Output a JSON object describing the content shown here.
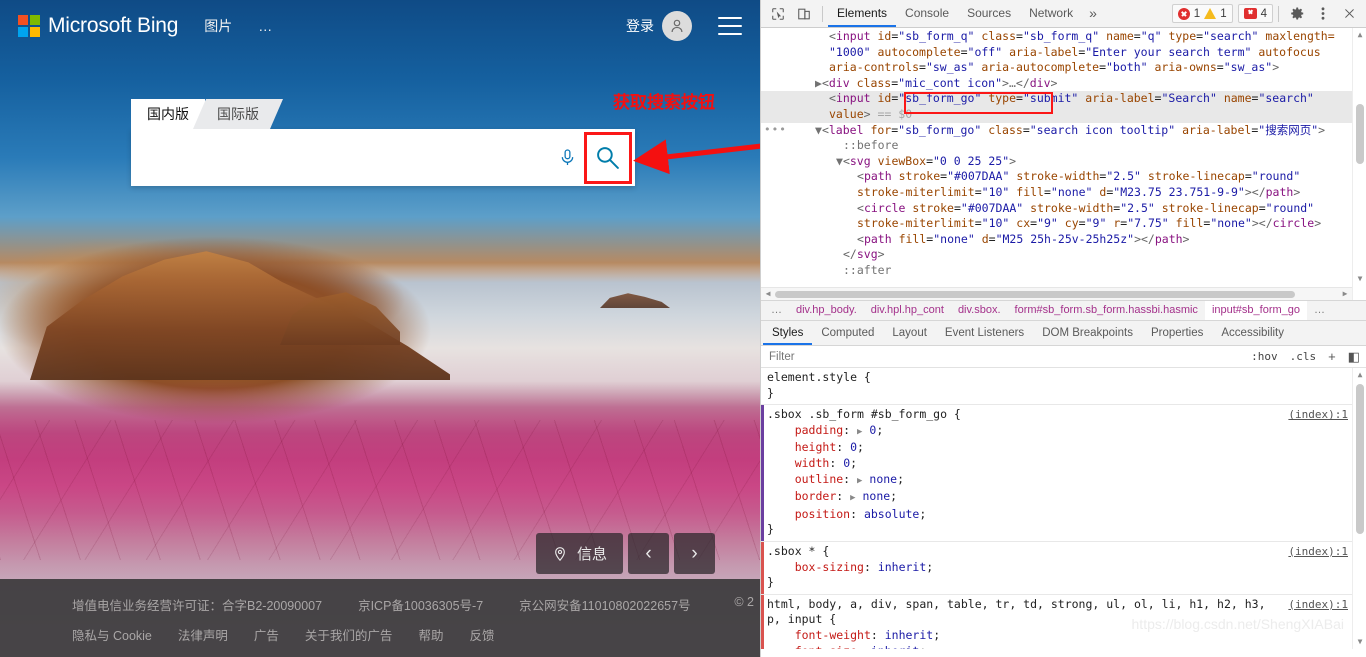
{
  "bing": {
    "brand": "Microsoft Bing",
    "nav": {
      "images": "图片",
      "more": "…"
    },
    "signin": "登录",
    "avatar_icon": "person-icon",
    "menu_icon": "hamburger-icon",
    "search": {
      "tab_domestic": "国内版",
      "tab_international": "国际版",
      "input_value": "",
      "input_placeholder": "",
      "mic_icon": "microphone-icon",
      "go_icon": "search-icon",
      "highlight_color": "#fb1717"
    },
    "annotation": {
      "text": "获取搜索按钮",
      "color": "#f41010"
    },
    "image_controls": {
      "info_label": "信息",
      "info_icon": "location-pin-icon",
      "prev_icon": "chevron-left-icon",
      "next_icon": "chevron-right-icon"
    },
    "footer": {
      "row1": [
        "增值电信业务经营许可证：合字B2-20090007",
        "京ICP备10036305号-7",
        "京公网安备11010802022657号"
      ],
      "copyright": "© 2",
      "row2": [
        "隐私与 Cookie",
        "法律声明",
        "广告",
        "关于我们的广告",
        "帮助",
        "反馈"
      ]
    }
  },
  "devtools": {
    "toolbar": {
      "inspect_icon": "inspect-cursor-icon",
      "device_icon": "device-toolbar-icon",
      "tabs": [
        "Elements",
        "Console",
        "Sources",
        "Network"
      ],
      "active_tab": "Elements",
      "more_tabs": "»",
      "error_count": "1",
      "warning_count": "1",
      "issue_count": "4",
      "settings_icon": "gear-icon",
      "kebab_icon": "more-vertical-icon",
      "close_icon": "close-icon"
    },
    "dom": {
      "lines": [
        {
          "indent": 8,
          "sel": false,
          "html": "<span class=\"pn\">&lt;</span><span class=\"tg\">input</span> <span class=\"at\">id</span>=<span class=\"av\">\"sb_form_q\"</span> <span class=\"at\">class</span>=<span class=\"av\">\"sb_form_q\"</span> <span class=\"at\">name</span>=<span class=\"av\">\"q\"</span> <span class=\"at\">type</span>=<span class=\"av\">\"search\"</span> <span class=\"at\">maxlength=</span>"
        },
        {
          "indent": 8,
          "sel": false,
          "html": "<span class=\"av\">\"1000\"</span> <span class=\"at\">autocomplete</span>=<span class=\"av\">\"off\"</span> <span class=\"at\">aria-label</span>=<span class=\"av\">\"Enter your search term\"</span> <span class=\"at\">autofocus</span>"
        },
        {
          "indent": 8,
          "sel": false,
          "html": "<span class=\"at\">aria-controls</span>=<span class=\"av\">\"sw_as\"</span> <span class=\"at\">aria-autocomplete</span>=<span class=\"av\">\"both\"</span> <span class=\"at\">aria-owns</span>=<span class=\"av\">\"sw_as\"</span><span class=\"pn\">&gt;</span>"
        },
        {
          "indent": 6,
          "sel": false,
          "html": "<span class=\"tri\">▶</span><span class=\"pn\">&lt;</span><span class=\"tg\">div</span> <span class=\"at\">class</span>=<span class=\"av\">\"mic_cont icon\"</span><span class=\"pn\">&gt;</span><span class=\"cm\">…</span><span class=\"pn\">&lt;/</span><span class=\"tg\">div</span><span class=\"pn\">&gt;</span>"
        },
        {
          "indent": 8,
          "sel": true,
          "html": "<span class=\"pn\">&lt;</span><span class=\"tg\">input</span> <span class=\"at\">id</span>=<span class=\"av\">\"sb_form_go\"</span> <span class=\"at\">type</span>=<span class=\"av\">\"submit\"</span> <span class=\"at\">aria-label</span>=<span class=\"av\">\"Search\"</span> <span class=\"at\">name</span>=<span class=\"av\">\"search\"</span>"
        },
        {
          "indent": 8,
          "sel": true,
          "html": "<span class=\"at\">value</span><span class=\"pn\">&gt;</span> <span class=\"eq0\">== $0</span>"
        },
        {
          "indent": 6,
          "sel": false,
          "html": "<span class=\"tri\">▼</span><span class=\"pn\">&lt;</span><span class=\"tg\">label</span> <span class=\"at\">for</span>=<span class=\"av\">\"sb_form_go\"</span> <span class=\"at\">class</span>=<span class=\"av\">\"search icon tooltip\"</span> <span class=\"at\">aria-label</span>=<span class=\"av\">\"搜索网页\"</span><span class=\"pn\">&gt;</span>"
        },
        {
          "indent": 10,
          "sel": false,
          "html": "<span class=\"cm\">::before</span>"
        },
        {
          "indent": 9,
          "sel": false,
          "html": "<span class=\"tri\">▼</span><span class=\"pn\">&lt;</span><span class=\"tg\">svg</span> <span class=\"at\">viewBox</span>=<span class=\"av\">\"0 0 25 25\"</span><span class=\"pn\">&gt;</span>"
        },
        {
          "indent": 12,
          "sel": false,
          "html": "<span class=\"pn\">&lt;</span><span class=\"tg\">path</span> <span class=\"at\">stroke</span>=<span class=\"av\">\"#007DAA\"</span> <span class=\"at\">stroke-width</span>=<span class=\"av\">\"2.5\"</span> <span class=\"at\">stroke-linecap</span>=<span class=\"av\">\"round\"</span>"
        },
        {
          "indent": 12,
          "sel": false,
          "html": "<span class=\"at\">stroke-miterlimit</span>=<span class=\"av\">\"10\"</span> <span class=\"at\">fill</span>=<span class=\"av\">\"none\"</span> <span class=\"at\">d</span>=<span class=\"av\">\"M23.75 23.751-9-9\"</span><span class=\"pn\">&gt;&lt;/</span><span class=\"tg\">path</span><span class=\"pn\">&gt;</span>"
        },
        {
          "indent": 12,
          "sel": false,
          "html": "<span class=\"pn\">&lt;</span><span class=\"tg\">circle</span> <span class=\"at\">stroke</span>=<span class=\"av\">\"#007DAA\"</span> <span class=\"at\">stroke-width</span>=<span class=\"av\">\"2.5\"</span> <span class=\"at\">stroke-linecap</span>=<span class=\"av\">\"round\"</span>"
        },
        {
          "indent": 12,
          "sel": false,
          "html": "<span class=\"at\">stroke-miterlimit</span>=<span class=\"av\">\"10\"</span> <span class=\"at\">cx</span>=<span class=\"av\">\"9\"</span> <span class=\"at\">cy</span>=<span class=\"av\">\"9\"</span> <span class=\"at\">r</span>=<span class=\"av\">\"7.75\"</span> <span class=\"at\">fill</span>=<span class=\"av\">\"none\"</span><span class=\"pn\">&gt;&lt;/</span><span class=\"tg\">circle</span><span class=\"pn\">&gt;</span>"
        },
        {
          "indent": 12,
          "sel": false,
          "html": "<span class=\"pn\">&lt;</span><span class=\"tg\">path</span> <span class=\"at\">fill</span>=<span class=\"av\">\"none\"</span> <span class=\"at\">d</span>=<span class=\"av\">\"M25 25h-25v-25h25z\"</span><span class=\"pn\">&gt;&lt;/</span><span class=\"tg\">path</span><span class=\"pn\">&gt;</span>"
        },
        {
          "indent": 10,
          "sel": false,
          "html": "<span class=\"pn\">&lt;/</span><span class=\"tg\">svg</span><span class=\"pn\">&gt;</span>"
        },
        {
          "indent": 10,
          "sel": false,
          "html": "<span class=\"cm\">::after</span>"
        }
      ],
      "gutter_dots": "•••"
    },
    "breadcrumbs": [
      {
        "label": "…",
        "type": "plain"
      },
      {
        "label": "div.hp_body.",
        "type": "node"
      },
      {
        "label": "div.hpl.hp_cont",
        "type": "node"
      },
      {
        "label": "div.sbox.",
        "type": "node"
      },
      {
        "label": "form#sb_form.sb_form.hassbi.hasmic",
        "type": "node"
      },
      {
        "label": "input#sb_form_go",
        "type": "last"
      },
      {
        "label": "…",
        "type": "plain"
      }
    ],
    "subtabs": [
      "Styles",
      "Computed",
      "Layout",
      "Event Listeners",
      "DOM Breakpoints",
      "Properties",
      "Accessibility"
    ],
    "active_subtab": "Styles",
    "filter": {
      "placeholder": "Filter",
      "value": "",
      "hov": ":hov",
      "cls": ".cls",
      "new_rule_icon": "plus-icon",
      "sidebar_icon": "toggle-sidebar-icon"
    },
    "styles_rules": [
      {
        "selector": "element.style {",
        "source": "",
        "decls": [],
        "close": "}"
      },
      {
        "selector": ".sbox .sb_form #sb_form_go {",
        "source": "(index):1",
        "decls": [
          {
            "prop": "padding",
            "value": "0",
            "expander": true
          },
          {
            "prop": "height",
            "value": "0",
            "expander": false
          },
          {
            "prop": "width",
            "value": "0",
            "expander": false
          },
          {
            "prop": "outline",
            "value": "none",
            "expander": true
          },
          {
            "prop": "border",
            "value": "none",
            "expander": true
          },
          {
            "prop": "position",
            "value": "absolute",
            "expander": false
          }
        ],
        "close": "}"
      },
      {
        "selector": ".sbox * {",
        "source": "(index):1",
        "decls": [
          {
            "prop": "box-sizing",
            "value": "inherit",
            "expander": false
          }
        ],
        "close": "}"
      },
      {
        "selector": "html, body, a, div, span, table, tr, td, strong, ul, ol, li, h1, h2, h3, p, input {",
        "source": "(index):1",
        "decls": [
          {
            "prop": "font-weight",
            "value": "inherit",
            "expander": false
          },
          {
            "prop": "font-size",
            "value": "inherit",
            "expander": false
          }
        ],
        "close": ""
      }
    ],
    "watermark": "https://blog.csdn.net/ShengXIABai"
  }
}
